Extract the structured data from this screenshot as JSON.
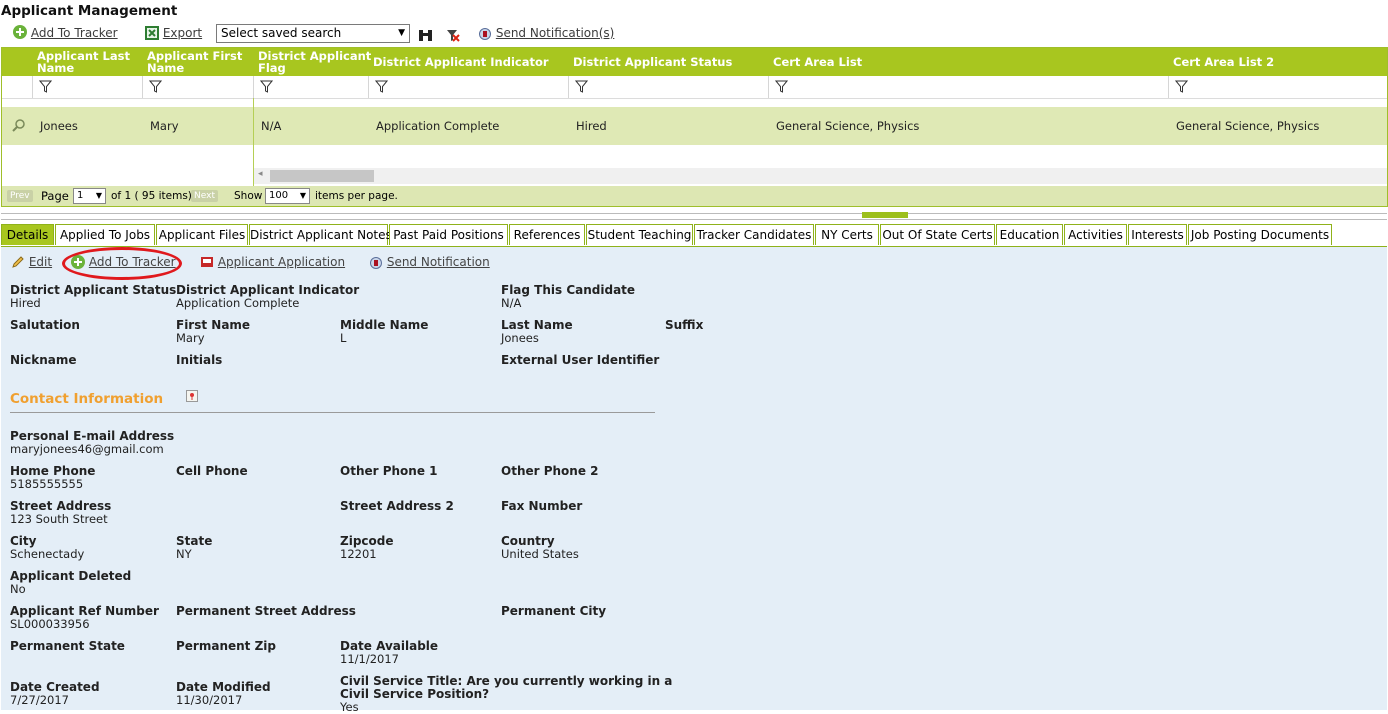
{
  "page_title": "Applicant Management",
  "toolbar": {
    "add_to_tracker": "Add To Tracker",
    "export": "Export",
    "saved_search_placeholder": "Select saved search",
    "send_notifications": "Send Notification(s)"
  },
  "grid": {
    "columns": [
      "Applicant Last Name",
      "Applicant First Name",
      "District Applicant Flag",
      "District Applicant Indicator",
      "District Applicant Status",
      "Cert Area List",
      "Cert Area List 2"
    ],
    "columns_split": [
      [
        "Applicant Last",
        "Name"
      ],
      [
        "Applicant First",
        "Name"
      ],
      [
        "District Applicant",
        "Flag"
      ]
    ],
    "row": {
      "last_name": "Jonees",
      "first_name": "Mary",
      "flag": "N/A",
      "indicator": "Application Complete",
      "status": "Hired",
      "cert_area": "General Science, Physics",
      "cert_area_2": "General Science, Physics"
    },
    "pager": {
      "prev": "Prev",
      "page_label": "Page",
      "page_value": "1",
      "of_text": "of 1 ( 95 items)",
      "next": "Next",
      "show_label": "Show",
      "page_size": "100",
      "per_page_text": "items per page."
    }
  },
  "tabs": [
    "Details",
    "Applied To Jobs",
    "Applicant Files",
    "District Applicant Notes",
    "Past Paid Positions",
    "References",
    "Student Teaching",
    "Tracker Candidates",
    "NY Certs",
    "Out Of State Certs",
    "Education",
    "Activities",
    "Interests",
    "Job Posting Documents"
  ],
  "actions": {
    "edit": "Edit",
    "add_to_tracker": "Add To Tracker",
    "applicant_application": "Applicant Application",
    "send_notification": "Send Notification"
  },
  "details": {
    "district_applicant_status": {
      "label": "District Applicant Status",
      "value": "Hired"
    },
    "district_applicant_indicator": {
      "label": "District Applicant Indicator",
      "value": "Application Complete"
    },
    "flag_this_candidate": {
      "label": "Flag This Candidate",
      "value": "N/A"
    },
    "salutation": {
      "label": "Salutation",
      "value": ""
    },
    "first_name": {
      "label": "First Name",
      "value": "Mary"
    },
    "middle_name": {
      "label": "Middle Name",
      "value": "L"
    },
    "last_name": {
      "label": "Last Name",
      "value": "Jonees"
    },
    "suffix": {
      "label": "Suffix",
      "value": ""
    },
    "nickname": {
      "label": "Nickname",
      "value": ""
    },
    "initials": {
      "label": "Initials",
      "value": ""
    },
    "external_user_identifier": {
      "label": "External User Identifier",
      "value": ""
    },
    "contact_section": "Contact Information",
    "personal_email": {
      "label": "Personal E-mail Address",
      "value": "maryjonees46@gmail.com"
    },
    "home_phone": {
      "label": "Home Phone",
      "value": "5185555555"
    },
    "cell_phone": {
      "label": "Cell Phone",
      "value": ""
    },
    "other_phone_1": {
      "label": "Other Phone 1",
      "value": ""
    },
    "other_phone_2": {
      "label": "Other Phone 2",
      "value": ""
    },
    "street_address": {
      "label": "Street Address",
      "value": "123 South Street"
    },
    "street_address_2": {
      "label": "Street Address 2",
      "value": ""
    },
    "fax_number": {
      "label": "Fax Number",
      "value": ""
    },
    "city": {
      "label": "City",
      "value": "Schenectady"
    },
    "state": {
      "label": "State",
      "value": "NY"
    },
    "zipcode": {
      "label": "Zipcode",
      "value": "12201"
    },
    "country": {
      "label": "Country",
      "value": "United States"
    },
    "applicant_deleted": {
      "label": "Applicant Deleted",
      "value": "No"
    },
    "applicant_ref_number": {
      "label": "Applicant Ref Number",
      "value": "SL000033956"
    },
    "permanent_street_address": {
      "label": "Permanent Street Address",
      "value": ""
    },
    "permanent_city": {
      "label": "Permanent City",
      "value": ""
    },
    "permanent_state": {
      "label": "Permanent State",
      "value": ""
    },
    "permanent_zip": {
      "label": "Permanent Zip",
      "value": ""
    },
    "date_available": {
      "label": "Date Available",
      "value": "11/1/2017"
    },
    "date_created": {
      "label": "Date Created",
      "value": "7/27/2017"
    },
    "date_modified": {
      "label": "Date Modified",
      "value": "11/30/2017"
    },
    "civil_service_title": {
      "label_line1": "Civil Service Title: Are you currently working in a",
      "label_line2": "Civil Service Position?",
      "value": "Yes"
    }
  },
  "colors": {
    "header_green": "#a8c61f",
    "row_green": "#dfe9b5",
    "panel_blue": "#e4eef7",
    "section_orange": "#f0a030",
    "highlight_red": "#e0191d"
  }
}
